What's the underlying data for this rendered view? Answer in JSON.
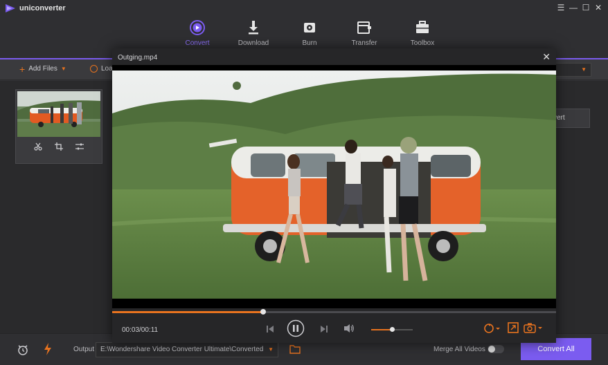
{
  "app": {
    "name": "uniconverter"
  },
  "window_controls": {
    "menu": "☰",
    "minimize": "—",
    "maximize": "☐",
    "close": "✕"
  },
  "nav": {
    "items": [
      {
        "label": "Convert",
        "icon": "convert-icon",
        "active": true
      },
      {
        "label": "Download",
        "icon": "download-icon",
        "active": false
      },
      {
        "label": "Burn",
        "icon": "burn-icon",
        "active": false
      },
      {
        "label": "Transfer",
        "icon": "transfer-icon",
        "active": false
      },
      {
        "label": "Toolbox",
        "icon": "toolbox-icon",
        "active": false
      }
    ]
  },
  "toolbar": {
    "add_files": "Add Files",
    "load": "Loa"
  },
  "side": {
    "convert_label": "vert"
  },
  "player": {
    "title": "Outging.mp4",
    "close": "✕",
    "time": "00:03/00:11",
    "progress": 0.34,
    "volume": 0.5
  },
  "bottom": {
    "output_label": "Output",
    "output_path": "E:\\Wondershare Video Converter Ultimate\\Converted",
    "merge_label": "Merge All Videos",
    "merge_on": false,
    "convert_all": "Convert All"
  },
  "colors": {
    "accent": "#7b5cf0",
    "orange": "#e8731f"
  }
}
